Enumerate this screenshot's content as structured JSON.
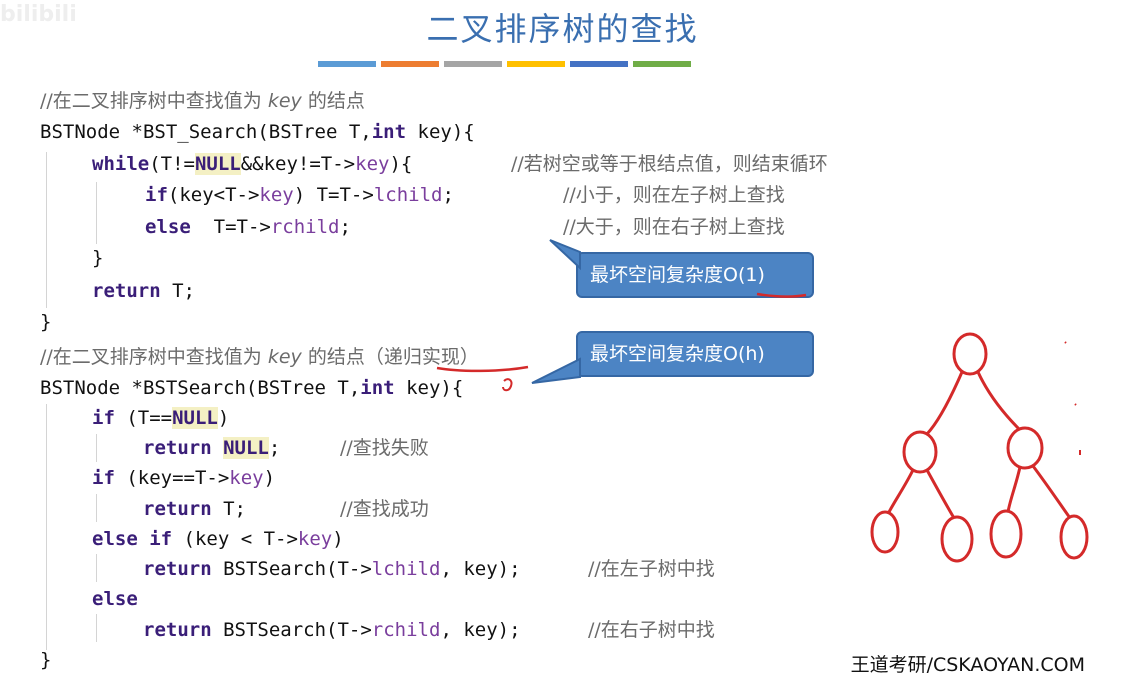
{
  "watermark": "bilibili",
  "title": "二叉排序树的查找",
  "title_bar_colors": [
    "#5b9bd5",
    "#ed7d31",
    "#a5a5a5",
    "#ffc000",
    "#4472c4",
    "#70ad47"
  ],
  "code1": {
    "comment_prefix": "//在二叉排序树中查找值为 ",
    "comment_key": "key",
    "comment_suffix": " 的结点",
    "sig_a": "BSTNode *BST_Search(BSTree T,",
    "sig_int": "int",
    "sig_b": " key){",
    "while_kw": "while",
    "while_a": "(T!=",
    "while_null": "NULL",
    "while_b": "&&key!=T->",
    "while_key": "key",
    "while_c": "){",
    "while_cm": "//若树空或等于根结点值，则结束循环",
    "if_kw": "if",
    "if_a": "(key<T->",
    "if_key": "key",
    "if_b": ") T=T->",
    "if_field": "lchild",
    "if_c": ";",
    "if_cm": "//小于，则在左子树上查找",
    "else_kw": "else",
    "else_a": "  T=T->",
    "else_field": "rchild",
    "else_b": ";",
    "else_cm": "//大于，则在右子树上查找",
    "close_inner": "}",
    "return_kw": "return",
    "return_a": " T;",
    "close_outer": "}"
  },
  "code2": {
    "comment_prefix": "//在二叉排序树中查找值为 ",
    "comment_key": "key",
    "comment_mid": " 的结点（",
    "comment_recursive": "递归实现",
    "comment_suffix": "）",
    "sig_a": "BSTNode *BSTSearch(BSTree T,",
    "sig_int": "int",
    "sig_b": " key){",
    "l1_kw": "if",
    "l1_a": " (T==",
    "l1_null": "NULL",
    "l1_b": ")",
    "l2_kw": "return",
    "l2_sp": " ",
    "l2_null": "NULL",
    "l2_b": ";",
    "l2_cm": "//查找失败",
    "l3_kw": "if",
    "l3_a": " (key==T->",
    "l3_key": "key",
    "l3_b": ")",
    "l4_kw": "return",
    "l4_a": " T;",
    "l4_cm": "//查找成功",
    "l5_kw": "else if",
    "l5_a": " (key < T->",
    "l5_key": "key",
    "l5_b": ")",
    "l6_kw": "return",
    "l6_a": " BSTSearch(T->",
    "l6_field": "lchild",
    "l6_b": ", key);",
    "l6_cm": "//在左子树中找",
    "l7_kw": "else",
    "l8_kw": "return",
    "l8_a": " BSTSearch(T->",
    "l8_field": "rchild",
    "l8_b": ", key);",
    "l8_cm": "//在右子树中找",
    "close": "}"
  },
  "callout1": {
    "text": "最坏空间复杂度O(1)"
  },
  "callout2": {
    "text": "最坏空间复杂度O(h)"
  },
  "footer": "王道考研/CSKAOYAN.COM"
}
